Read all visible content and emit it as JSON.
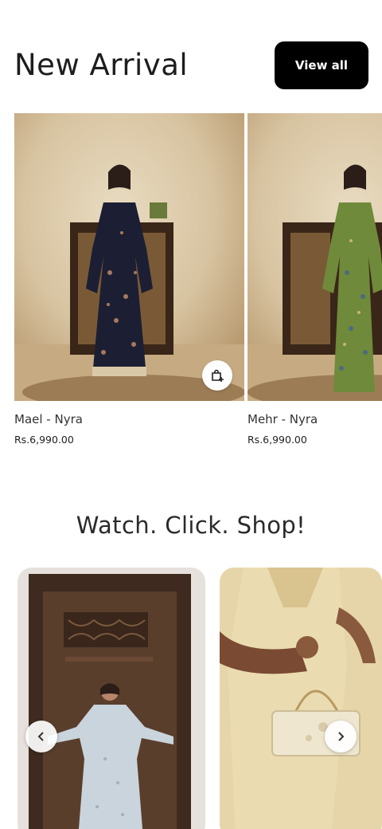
{
  "new_arrival": {
    "title": "New Arrival",
    "view_all_label": "View all",
    "products": [
      {
        "name": "Mael - Nyra",
        "price": "Rs.6,990.00"
      },
      {
        "name": "Mehr - Nyra",
        "price": "Rs.6,990.00"
      }
    ]
  },
  "watch_section": {
    "title": "Watch. Click. Shop!"
  },
  "icons": {
    "bag": "shopping-bag-plus-icon",
    "prev": "chevron-left-icon",
    "next": "chevron-right-icon"
  },
  "colors": {
    "button_bg": "#000000",
    "button_text": "#ffffff",
    "dress_1": "#1c1f33",
    "dress_2": "#6f8a3a"
  }
}
